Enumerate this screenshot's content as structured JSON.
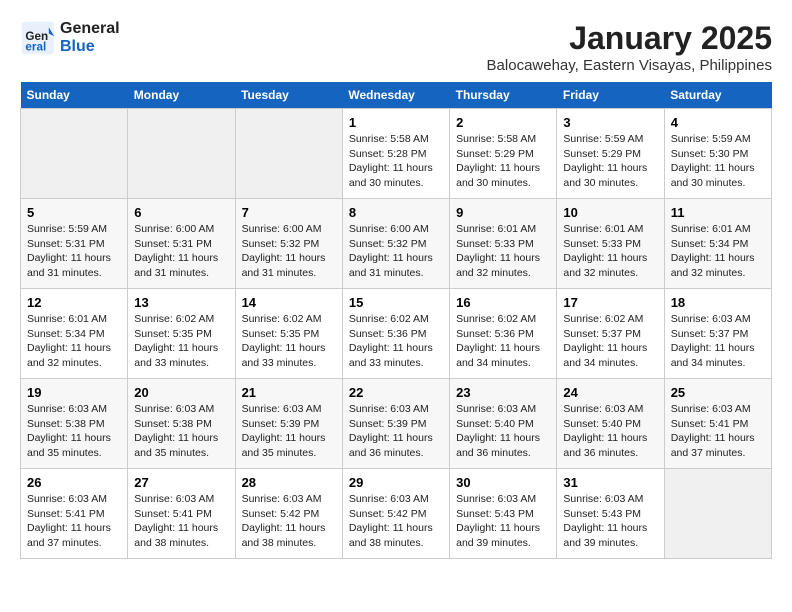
{
  "header": {
    "logo_line1": "General",
    "logo_line2": "Blue",
    "month_title": "January 2025",
    "subtitle": "Balocawehay, Eastern Visayas, Philippines"
  },
  "weekdays": [
    "Sunday",
    "Monday",
    "Tuesday",
    "Wednesday",
    "Thursday",
    "Friday",
    "Saturday"
  ],
  "weeks": [
    [
      {
        "day": "",
        "empty": true
      },
      {
        "day": "",
        "empty": true
      },
      {
        "day": "",
        "empty": true
      },
      {
        "day": "1",
        "sunrise": "Sunrise: 5:58 AM",
        "sunset": "Sunset: 5:28 PM",
        "daylight": "Daylight: 11 hours and 30 minutes."
      },
      {
        "day": "2",
        "sunrise": "Sunrise: 5:58 AM",
        "sunset": "Sunset: 5:29 PM",
        "daylight": "Daylight: 11 hours and 30 minutes."
      },
      {
        "day": "3",
        "sunrise": "Sunrise: 5:59 AM",
        "sunset": "Sunset: 5:29 PM",
        "daylight": "Daylight: 11 hours and 30 minutes."
      },
      {
        "day": "4",
        "sunrise": "Sunrise: 5:59 AM",
        "sunset": "Sunset: 5:30 PM",
        "daylight": "Daylight: 11 hours and 30 minutes."
      }
    ],
    [
      {
        "day": "5",
        "sunrise": "Sunrise: 5:59 AM",
        "sunset": "Sunset: 5:31 PM",
        "daylight": "Daylight: 11 hours and 31 minutes."
      },
      {
        "day": "6",
        "sunrise": "Sunrise: 6:00 AM",
        "sunset": "Sunset: 5:31 PM",
        "daylight": "Daylight: 11 hours and 31 minutes."
      },
      {
        "day": "7",
        "sunrise": "Sunrise: 6:00 AM",
        "sunset": "Sunset: 5:32 PM",
        "daylight": "Daylight: 11 hours and 31 minutes."
      },
      {
        "day": "8",
        "sunrise": "Sunrise: 6:00 AM",
        "sunset": "Sunset: 5:32 PM",
        "daylight": "Daylight: 11 hours and 31 minutes."
      },
      {
        "day": "9",
        "sunrise": "Sunrise: 6:01 AM",
        "sunset": "Sunset: 5:33 PM",
        "daylight": "Daylight: 11 hours and 32 minutes."
      },
      {
        "day": "10",
        "sunrise": "Sunrise: 6:01 AM",
        "sunset": "Sunset: 5:33 PM",
        "daylight": "Daylight: 11 hours and 32 minutes."
      },
      {
        "day": "11",
        "sunrise": "Sunrise: 6:01 AM",
        "sunset": "Sunset: 5:34 PM",
        "daylight": "Daylight: 11 hours and 32 minutes."
      }
    ],
    [
      {
        "day": "12",
        "sunrise": "Sunrise: 6:01 AM",
        "sunset": "Sunset: 5:34 PM",
        "daylight": "Daylight: 11 hours and 32 minutes."
      },
      {
        "day": "13",
        "sunrise": "Sunrise: 6:02 AM",
        "sunset": "Sunset: 5:35 PM",
        "daylight": "Daylight: 11 hours and 33 minutes."
      },
      {
        "day": "14",
        "sunrise": "Sunrise: 6:02 AM",
        "sunset": "Sunset: 5:35 PM",
        "daylight": "Daylight: 11 hours and 33 minutes."
      },
      {
        "day": "15",
        "sunrise": "Sunrise: 6:02 AM",
        "sunset": "Sunset: 5:36 PM",
        "daylight": "Daylight: 11 hours and 33 minutes."
      },
      {
        "day": "16",
        "sunrise": "Sunrise: 6:02 AM",
        "sunset": "Sunset: 5:36 PM",
        "daylight": "Daylight: 11 hours and 34 minutes."
      },
      {
        "day": "17",
        "sunrise": "Sunrise: 6:02 AM",
        "sunset": "Sunset: 5:37 PM",
        "daylight": "Daylight: 11 hours and 34 minutes."
      },
      {
        "day": "18",
        "sunrise": "Sunrise: 6:03 AM",
        "sunset": "Sunset: 5:37 PM",
        "daylight": "Daylight: 11 hours and 34 minutes."
      }
    ],
    [
      {
        "day": "19",
        "sunrise": "Sunrise: 6:03 AM",
        "sunset": "Sunset: 5:38 PM",
        "daylight": "Daylight: 11 hours and 35 minutes."
      },
      {
        "day": "20",
        "sunrise": "Sunrise: 6:03 AM",
        "sunset": "Sunset: 5:38 PM",
        "daylight": "Daylight: 11 hours and 35 minutes."
      },
      {
        "day": "21",
        "sunrise": "Sunrise: 6:03 AM",
        "sunset": "Sunset: 5:39 PM",
        "daylight": "Daylight: 11 hours and 35 minutes."
      },
      {
        "day": "22",
        "sunrise": "Sunrise: 6:03 AM",
        "sunset": "Sunset: 5:39 PM",
        "daylight": "Daylight: 11 hours and 36 minutes."
      },
      {
        "day": "23",
        "sunrise": "Sunrise: 6:03 AM",
        "sunset": "Sunset: 5:40 PM",
        "daylight": "Daylight: 11 hours and 36 minutes."
      },
      {
        "day": "24",
        "sunrise": "Sunrise: 6:03 AM",
        "sunset": "Sunset: 5:40 PM",
        "daylight": "Daylight: 11 hours and 36 minutes."
      },
      {
        "day": "25",
        "sunrise": "Sunrise: 6:03 AM",
        "sunset": "Sunset: 5:41 PM",
        "daylight": "Daylight: 11 hours and 37 minutes."
      }
    ],
    [
      {
        "day": "26",
        "sunrise": "Sunrise: 6:03 AM",
        "sunset": "Sunset: 5:41 PM",
        "daylight": "Daylight: 11 hours and 37 minutes."
      },
      {
        "day": "27",
        "sunrise": "Sunrise: 6:03 AM",
        "sunset": "Sunset: 5:41 PM",
        "daylight": "Daylight: 11 hours and 38 minutes."
      },
      {
        "day": "28",
        "sunrise": "Sunrise: 6:03 AM",
        "sunset": "Sunset: 5:42 PM",
        "daylight": "Daylight: 11 hours and 38 minutes."
      },
      {
        "day": "29",
        "sunrise": "Sunrise: 6:03 AM",
        "sunset": "Sunset: 5:42 PM",
        "daylight": "Daylight: 11 hours and 38 minutes."
      },
      {
        "day": "30",
        "sunrise": "Sunrise: 6:03 AM",
        "sunset": "Sunset: 5:43 PM",
        "daylight": "Daylight: 11 hours and 39 minutes."
      },
      {
        "day": "31",
        "sunrise": "Sunrise: 6:03 AM",
        "sunset": "Sunset: 5:43 PM",
        "daylight": "Daylight: 11 hours and 39 minutes."
      },
      {
        "day": "",
        "empty": true
      }
    ]
  ]
}
